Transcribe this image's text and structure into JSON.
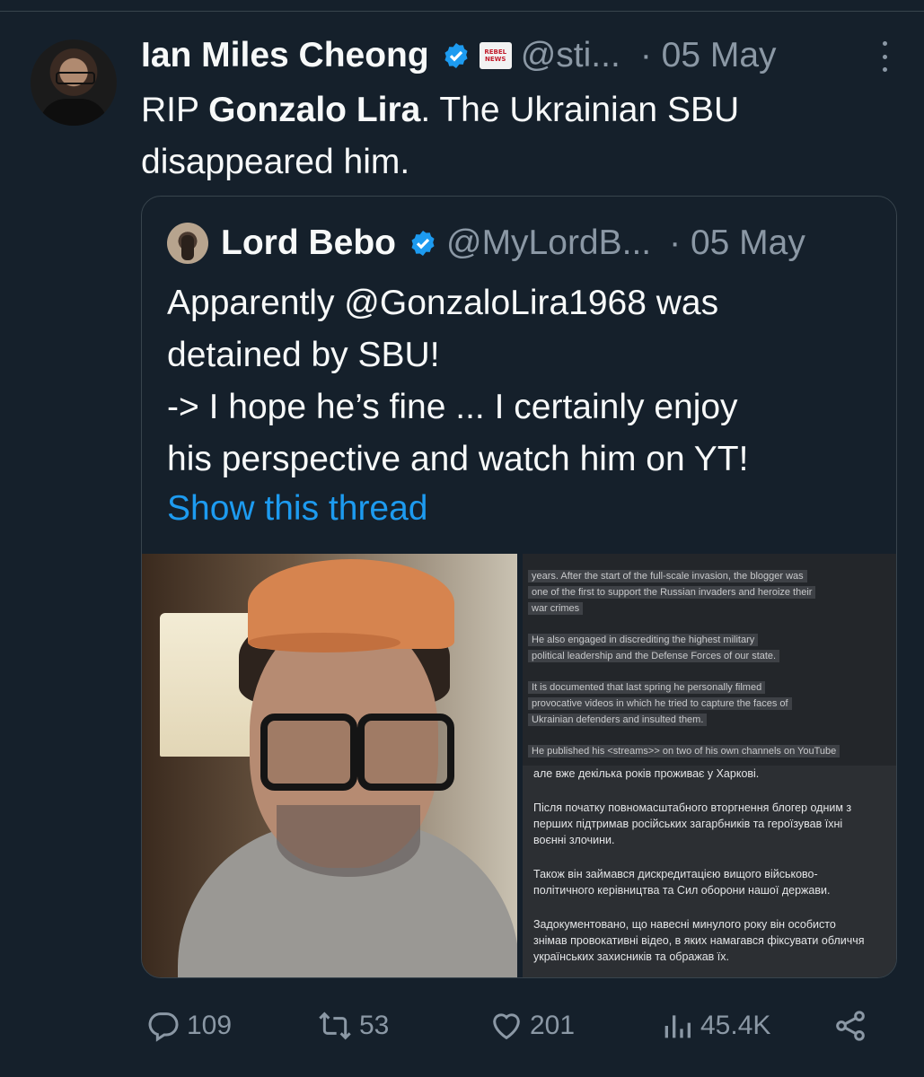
{
  "tweet": {
    "author": {
      "name": "Ian Miles Cheong",
      "handle": "@sti...",
      "date": "· 05 May"
    },
    "text_parts": [
      "RIP ",
      "Gonzalo Lira",
      ". The Ukrainian SBU disappeared him."
    ],
    "quoted": {
      "author": {
        "name": "Lord Bebo",
        "handle": "@MyLordB...",
        "date": "· 05 May"
      },
      "lines": [
        "Apparently @GonzaloLira1968 was",
        "detained by SBU!",
        "-> I hope he’s fine ... I certainly enjoy",
        "his perspective and watch him on YT!"
      ],
      "show_thread": "Show this thread",
      "doc_en": [
        "years. After the start of the full-scale invasion, the blogger was",
        "one of the first to support the Russian invaders and heroize their",
        "war crimes",
        "He also engaged in discrediting the highest military",
        "political leadership and the Defense Forces of our state.",
        "It is documented that last spring he personally filmed",
        "provocative videos in which he tried to capture the faces of",
        "Ukrainian defenders and insulted them.",
        "He published his <streams>> on two of his own channels on YouTube"
      ],
      "doc_uk": [
        "але вже декілька років проживає у Харкові.",
        "Після початку повномасштабного вторгнення блогер одним з",
        "перших підтримав російських загарбників та героїзував їхні",
        "воєнні злочини.",
        "Також він займався дискредитацією вищого військово-",
        "політичного керівництва та Сил оборони нашої держави.",
        "Задокументовано, що навесні минулого року він особисто",
        "знімав провокативні відео, в яких намагався фіксувати обличчя",
        "українських захисників та ображав їх."
      ]
    },
    "stats": {
      "replies": "109",
      "reposts": "53",
      "likes": "201",
      "views": "45.4K"
    }
  },
  "icons": [
    "verified-badge-icon",
    "rebel-news-badge-icon",
    "more-options-icon",
    "reply-icon",
    "repost-icon",
    "like-icon",
    "views-icon",
    "share-icon"
  ],
  "badge_text": [
    "REBEL",
    "NEWS"
  ],
  "colors": {
    "background": "#15202b",
    "text": "#f7f9f9",
    "secondary": "#8b98a5",
    "link": "#1d9bf0",
    "border": "#38444d",
    "verified": "#1d9bf0"
  }
}
